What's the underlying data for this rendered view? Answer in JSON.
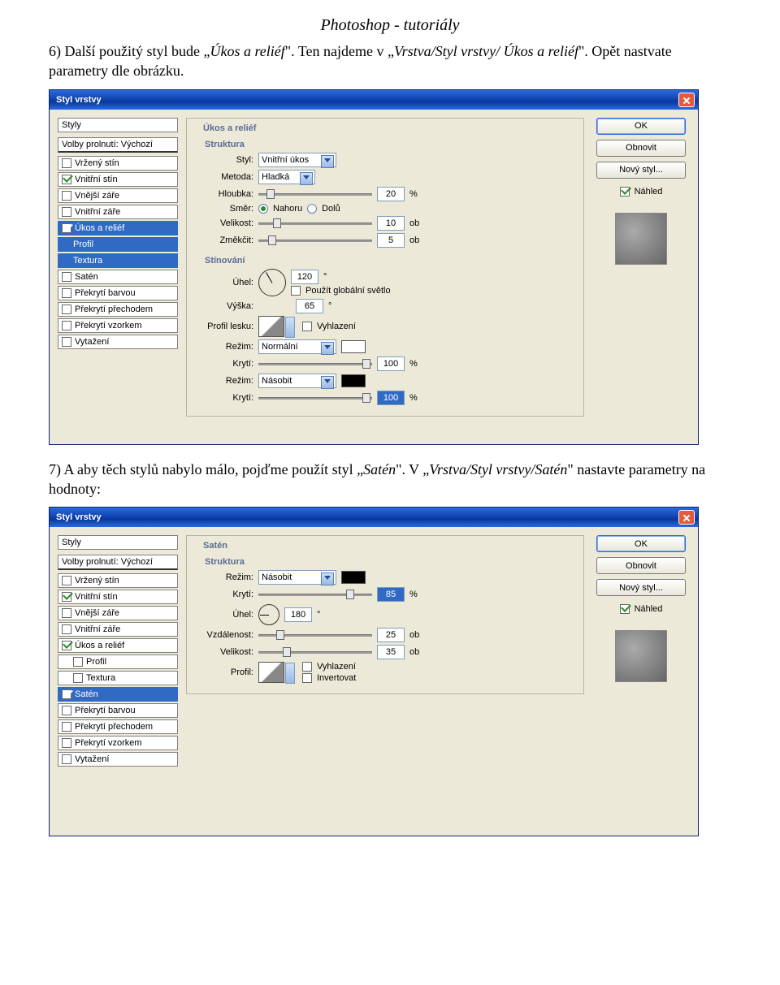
{
  "page_title": "Photoshop - tutoriály",
  "p6_a": "6) Další použitý styl bude „",
  "p6_b": "Úkos a reliéf",
  "p6_c": "\". Ten najdeme v „",
  "p6_d": "Vrstva/Styl vrstvy/ Úkos a reliéf",
  "p6_e": "\". Opět nastvate parametry dle obrázku.",
  "p7_a": "7) A aby těch stylů nabylo málo, pojďme použít styl „",
  "p7_b": "Satén",
  "p7_c": "\". V „",
  "p7_d": "Vrstva/Styl vrstvy/Satén",
  "p7_e": "\" nastavte parametry na hodnoty:",
  "dlg": {
    "title": "Styl vrstvy",
    "ok": "OK",
    "reset": "Obnovit",
    "newstyle": "Nový styl...",
    "preview": "Náhled"
  },
  "side": {
    "header": "Styly",
    "blend": "Volby prolnutí: Výchozí",
    "items": [
      "Vržený stín",
      "Vnitřní stín",
      "Vnější záře",
      "Vnitřní záře",
      "Úkos a reliéf",
      "Profil",
      "Textura",
      "Satén",
      "Překrytí barvou",
      "Překrytí přechodem",
      "Překrytí vzorkem",
      "Vytažení"
    ]
  },
  "bevel": {
    "group": "Úkos a reliéf",
    "struct": "Struktura",
    "style_l": "Styl:",
    "style_v": "Vnitřní úkos",
    "tech_l": "Metoda:",
    "tech_v": "Hladká",
    "depth_l": "Hloubka:",
    "depth_v": "20",
    "pct": "%",
    "dir_l": "Směr:",
    "up": "Nahoru",
    "down": "Dolů",
    "size_l": "Velikost:",
    "size_v": "10",
    "px": "ob",
    "soft_l": "Změkčit:",
    "soft_v": "5",
    "shade": "Stínování",
    "angle_l": "Úhel:",
    "angle_v": "120",
    "global": "Použít globální světlo",
    "alt_l": "Výška:",
    "alt_v": "65",
    "gloss_l": "Profil lesku:",
    "aa": "Vyhlazení",
    "hmode_l": "Režim:",
    "hmode_v": "Normální",
    "hop_l": "Krytí:",
    "hop_v": "100",
    "smode_l": "Režim:",
    "smode_v": "Násobit",
    "sop_l": "Krytí:",
    "sop_v": "100"
  },
  "satin": {
    "group": "Satén",
    "struct": "Struktura",
    "mode_l": "Režim:",
    "mode_v": "Násobit",
    "op_l": "Krytí:",
    "op_v": "85",
    "pct": "%",
    "angle_l": "Úhel:",
    "angle_v": "180",
    "dist_l": "Vzdálenost:",
    "dist_v": "25",
    "px": "ob",
    "size_l": "Velikost:",
    "size_v": "35",
    "prof_l": "Profil:",
    "aa": "Vyhlazení",
    "inv": "Invertovat"
  }
}
